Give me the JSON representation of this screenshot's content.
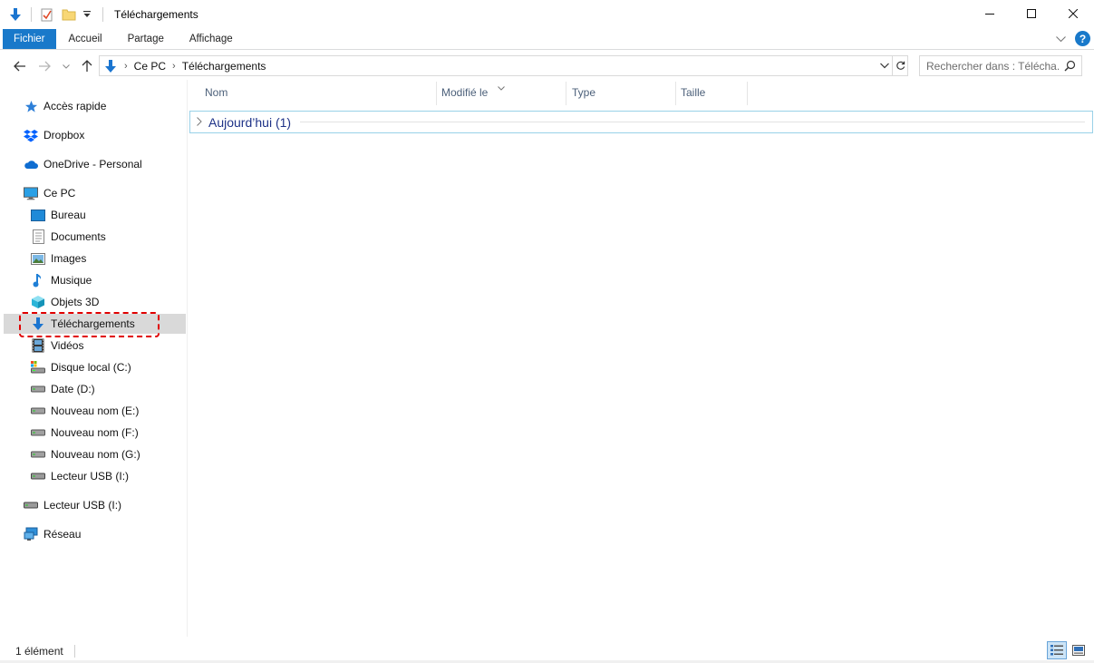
{
  "window": {
    "title": "Téléchargements",
    "controls": [
      "minimize-icon",
      "maximize-icon",
      "close-icon"
    ]
  },
  "quick_access_toolbar": {
    "icons": [
      "download-icon",
      "properties-icon",
      "new-folder-icon",
      "customize-dropdown-icon"
    ]
  },
  "ribbon": {
    "tabs": [
      "Fichier",
      "Accueil",
      "Partage",
      "Affichage"
    ],
    "active_tab": "Fichier",
    "file_tab_color": "#1979ca"
  },
  "address_bar": {
    "crumbs": [
      "Ce PC",
      "Téléchargements"
    ]
  },
  "search": {
    "placeholder": "Rechercher dans : Télécha..."
  },
  "nav_pane": {
    "items": [
      {
        "label": "Accès rapide",
        "icon": "star-icon",
        "level": 1
      },
      {
        "label": "Dropbox",
        "icon": "dropbox-icon",
        "level": 1
      },
      {
        "label": "OneDrive - Personal",
        "icon": "cloud-icon",
        "level": 1
      },
      {
        "label": "Ce PC",
        "icon": "computer-icon",
        "level": 1
      },
      {
        "label": "Bureau",
        "icon": "desktop-icon",
        "level": 2
      },
      {
        "label": "Documents",
        "icon": "document-icon",
        "level": 2
      },
      {
        "label": "Images",
        "icon": "image-icon",
        "level": 2
      },
      {
        "label": "Musique",
        "icon": "music-icon",
        "level": 2
      },
      {
        "label": "Objets 3D",
        "icon": "cube-icon",
        "level": 2
      },
      {
        "label": "Téléchargements",
        "icon": "download-icon",
        "level": 2,
        "selected": true
      },
      {
        "label": "Vidéos",
        "icon": "film-icon",
        "level": 2
      },
      {
        "label": "Disque local (C:)",
        "icon": "system-drive-icon",
        "level": 2
      },
      {
        "label": "Date (D:)",
        "icon": "drive-icon",
        "level": 2
      },
      {
        "label": "Nouveau nom (E:)",
        "icon": "drive-icon",
        "level": 2
      },
      {
        "label": "Nouveau nom (F:)",
        "icon": "drive-icon",
        "level": 2
      },
      {
        "label": "Nouveau nom (G:)",
        "icon": "drive-icon",
        "level": 2
      },
      {
        "label": "Lecteur USB (I:)",
        "icon": "usb-drive-icon",
        "level": 2
      },
      {
        "label": "Lecteur USB (I:)",
        "icon": "usb-drive-icon",
        "level": 1
      },
      {
        "label": "Réseau",
        "icon": "network-icon",
        "level": 1
      }
    ],
    "highlight_color": "#e00000"
  },
  "columns": [
    "Nom",
    "Modifié le",
    "Type",
    "Taille"
  ],
  "groups": [
    {
      "label": "Aujourd’hui (1)",
      "collapsed": true
    }
  ],
  "status": {
    "item_count": "1 élément"
  },
  "view_buttons": [
    "details-view-icon",
    "large-icons-view-icon"
  ]
}
